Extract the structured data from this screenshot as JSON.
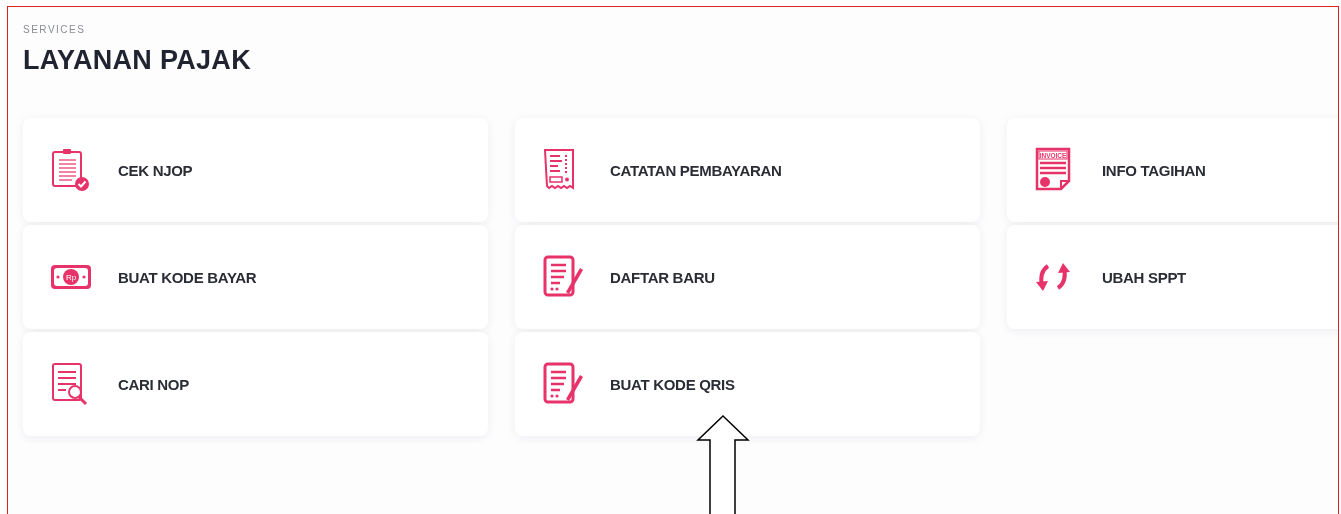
{
  "header": {
    "eyebrow": "SERVICES",
    "title": "LAYANAN PAJAK"
  },
  "columns": [
    [
      {
        "label": "CEK NJOP",
        "kind": "clipboard"
      },
      {
        "label": "BUAT KODE BAYAR",
        "kind": "money",
        "icon_label": "Rp"
      },
      {
        "label": "CARI NOP",
        "kind": "search"
      }
    ],
    [
      {
        "label": "CATATAN PEMBAYARAN",
        "kind": "receipt"
      },
      {
        "label": "DAFTAR BARU",
        "kind": "edit"
      },
      {
        "label": "BUAT KODE QRIS",
        "kind": "edit"
      }
    ],
    [
      {
        "label": "INFO TAGIHAN",
        "kind": "invoice",
        "icon_label": "INVOICE"
      },
      {
        "label": "UBAH SPPT",
        "kind": "refresh"
      }
    ]
  ],
  "annotation": {
    "kind": "arrow"
  }
}
